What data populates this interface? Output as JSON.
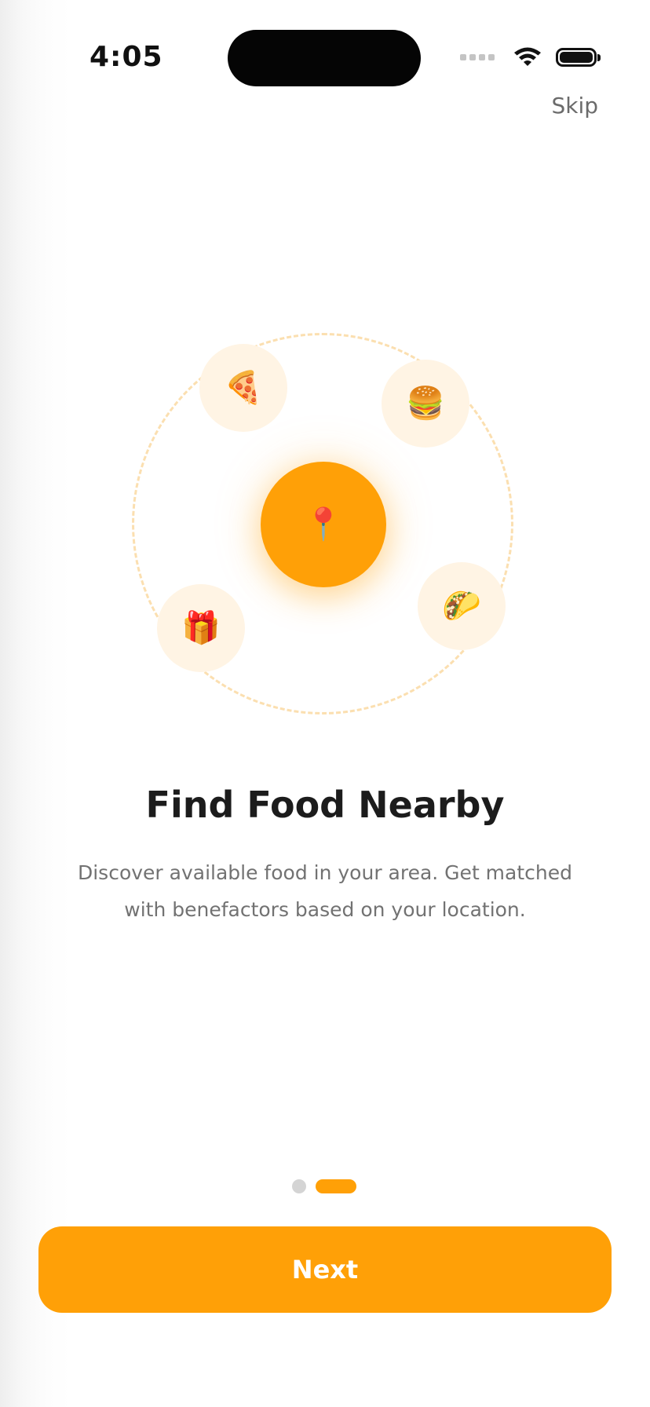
{
  "status_bar": {
    "time": "4:05"
  },
  "header": {
    "skip_label": "Skip"
  },
  "illustration": {
    "center_icon": "📍",
    "food_icons": {
      "pizza": "🍕",
      "burger": "🍔",
      "taco": "🌮",
      "gift": "🎁"
    },
    "accent_color": "#ffa007",
    "bubble_color": "#fff4e4"
  },
  "content": {
    "title": "Find Food Nearby",
    "description": "Discover available food in your area. Get matched with benefactors based on your location."
  },
  "pager": {
    "total_pages": 2,
    "current_page": 2
  },
  "actions": {
    "next_label": "Next"
  }
}
